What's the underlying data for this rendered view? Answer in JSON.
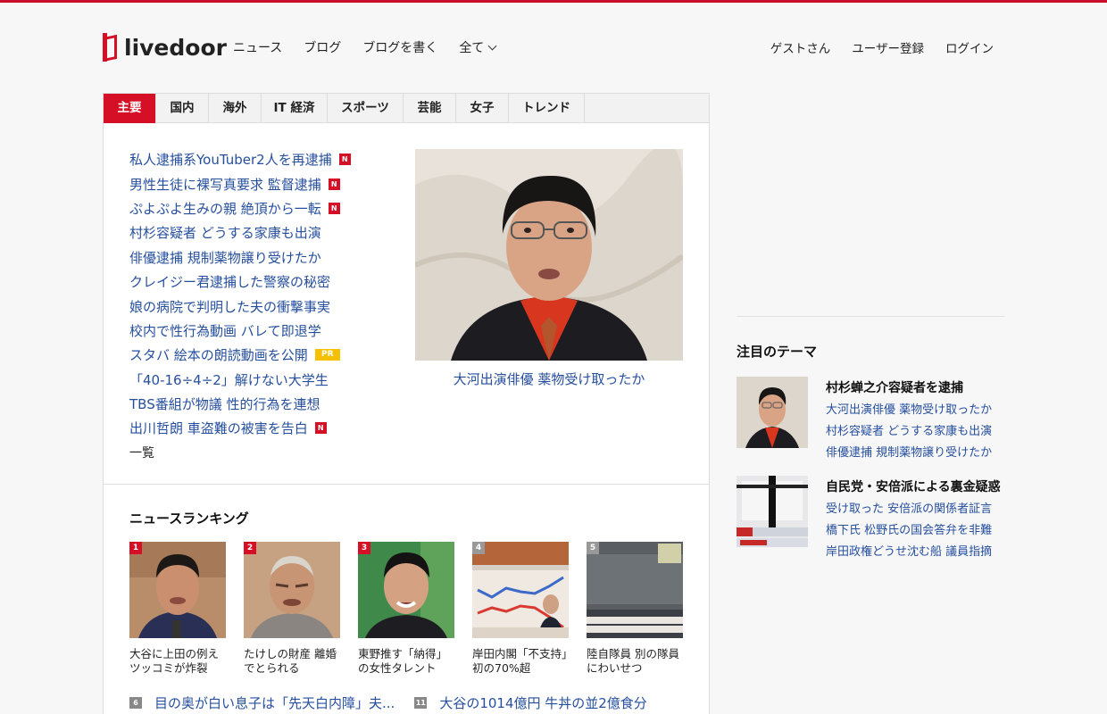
{
  "logo": {
    "text": "livedoor"
  },
  "nav": {
    "items": [
      "ニュース",
      "ブログ",
      "ブログを書く",
      "全て"
    ]
  },
  "user_nav": {
    "items": [
      "ゲストさん",
      "ユーザー登録",
      "ログイン"
    ]
  },
  "tabs": [
    "主要",
    "国内",
    "海外",
    "IT 経済",
    "スポーツ",
    "芸能",
    "女子",
    "トレンド"
  ],
  "headlines": [
    {
      "text": "私人逮捕系YouTuber2人を再逮捕",
      "badge": "N"
    },
    {
      "text": "男性生徒に裸写真要求 監督逮捕",
      "badge": "N"
    },
    {
      "text": "ぷよぷよ生みの親 絶頂から一転",
      "badge": "N"
    },
    {
      "text": "村杉容疑者 どうする家康も出演",
      "badge": ""
    },
    {
      "text": "俳優逮捕 規制薬物譲り受けたか",
      "badge": ""
    },
    {
      "text": "クレイジー君逮捕した警察の秘密",
      "badge": ""
    },
    {
      "text": "娘の病院で判明した夫の衝撃事実",
      "badge": ""
    },
    {
      "text": "校内で性行為動画 バレて即退学",
      "badge": ""
    },
    {
      "text": "スタバ 絵本の朗読動画を公開",
      "badge": "PR"
    },
    {
      "text": "「40-16÷4÷2」解けない大学生",
      "badge": ""
    },
    {
      "text": "TBS番組が物議 性的行為を連想",
      "badge": ""
    },
    {
      "text": "出川哲朗 車盗難の被害を告白",
      "badge": "N"
    }
  ],
  "more_link": "一覧",
  "feature": {
    "caption": "大河出演俳優 薬物受け取ったか"
  },
  "ranking": {
    "title": "ニュースランキング",
    "items": [
      {
        "rank": "1",
        "text": "大谷に上田の例えツッコミが炸裂"
      },
      {
        "rank": "2",
        "text": "たけしの財産 離婚でとられる"
      },
      {
        "rank": "3",
        "text": "東野推す「納得」の女性タレント"
      },
      {
        "rank": "4",
        "text": "岸田内閣「不支持」初の70%超"
      },
      {
        "rank": "5",
        "text": "陸自隊員 別の隊員にわいせつ"
      }
    ],
    "list": [
      {
        "rank": "6",
        "text": "目の奥が白い息子は「先天白内障」夫..."
      },
      {
        "rank": "11",
        "text": "大谷の1014億円 牛丼の並2億食分"
      }
    ]
  },
  "sidebar": {
    "title": "注目のテーマ",
    "themes": [
      {
        "title": "村杉蝉之介容疑者を逮捕",
        "links": [
          "大河出演俳優 薬物受け取ったか",
          "村杉容疑者 どうする家康も出演",
          "俳優逮捕 規制薬物譲り受けたか"
        ]
      },
      {
        "title": "自民党・安倍派による裏金疑惑",
        "links": [
          "受け取った 安倍派の関係者証言",
          "橋下氏 松野氏の国会答弁を非難",
          "岸田政権どうせ沈む船 議員指摘"
        ]
      }
    ]
  },
  "colors": {
    "brand": "#d50f25",
    "link": "#264f9e",
    "pr": "#f5c000"
  }
}
